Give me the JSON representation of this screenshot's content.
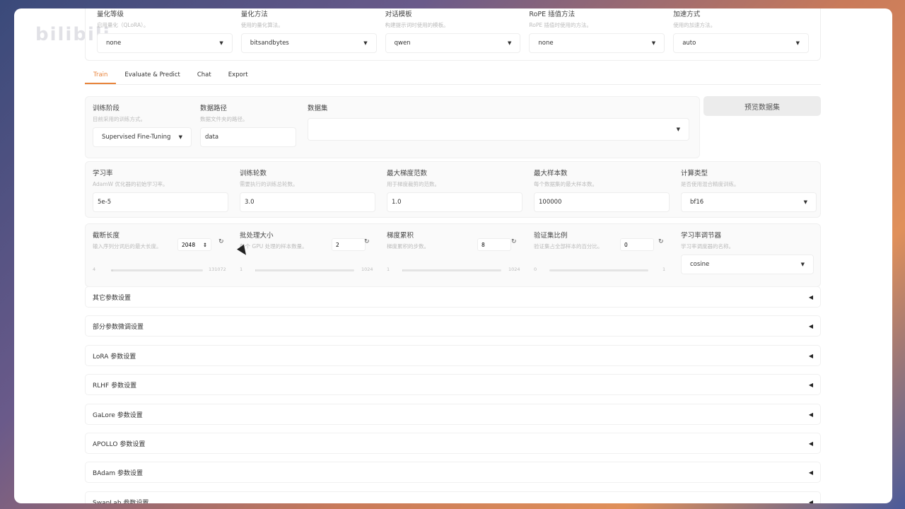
{
  "watermark": "bilibili",
  "top": [
    {
      "label": "量化等级",
      "hint": "启用量化（QLoRA）。",
      "value": "none"
    },
    {
      "label": "量化方法",
      "hint": "使用的量化算法。",
      "value": "bitsandbytes"
    },
    {
      "label": "对话模板",
      "hint": "构建提示词时使用的模板。",
      "value": "qwen"
    },
    {
      "label": "RoPE 插值方法",
      "hint": "RoPE 插值时使用的方法。",
      "value": "none"
    },
    {
      "label": "加速方式",
      "hint": "使用的加速方法。",
      "value": "auto"
    }
  ],
  "tabs": [
    "Train",
    "Evaluate & Predict",
    "Chat",
    "Export"
  ],
  "row1": {
    "stage": {
      "label": "训练阶段",
      "hint": "目前采用的训练方式。",
      "value": "Supervised Fine-Tuning"
    },
    "datadir": {
      "label": "数据路径",
      "hint": "数据文件夹的路径。",
      "value": "data"
    },
    "dataset": {
      "label": "数据集",
      "value": ""
    },
    "preview": "预览数据集"
  },
  "row2": [
    {
      "label": "学习率",
      "hint": "AdamW 优化器的初始学习率。",
      "value": "5e-5"
    },
    {
      "label": "训练轮数",
      "hint": "需要执行的训练总轮数。",
      "value": "3.0"
    },
    {
      "label": "最大梯度范数",
      "hint": "用于梯度裁剪的范数。",
      "value": "1.0"
    },
    {
      "label": "最大样本数",
      "hint": "每个数据集的最大样本数。",
      "value": "100000"
    },
    {
      "label": "计算类型",
      "hint": "是否使用混合精度训练。",
      "value": "bf16"
    }
  ],
  "row3": [
    {
      "label": "截断长度",
      "hint": "输入序列分词后的最大长度。",
      "value": "2048",
      "min": "4",
      "max": "131072",
      "fill": 0.02
    },
    {
      "label": "批处理大小",
      "hint": "每个 GPU 处理的样本数量。",
      "value": "2",
      "min": "1",
      "max": "1024",
      "fill": 0.002
    },
    {
      "label": "梯度累积",
      "hint": "梯度累积的步数。",
      "value": "8",
      "min": "1",
      "max": "1024",
      "fill": 0.007
    },
    {
      "label": "验证集比例",
      "hint": "验证集占全部样本的百分比。",
      "value": "0",
      "min": "0",
      "max": "1",
      "fill": 0.0
    }
  ],
  "scheduler": {
    "label": "学习率调节器",
    "hint": "学习率调度器的名称。",
    "value": "cosine"
  },
  "accordions": [
    "其它参数设置",
    "部分参数微调设置",
    "LoRA 参数设置",
    "RLHF 参数设置",
    "GaLore 参数设置",
    "APOLLO 参数设置",
    "BAdam 参数设置",
    "SwanLab 参数设置"
  ]
}
